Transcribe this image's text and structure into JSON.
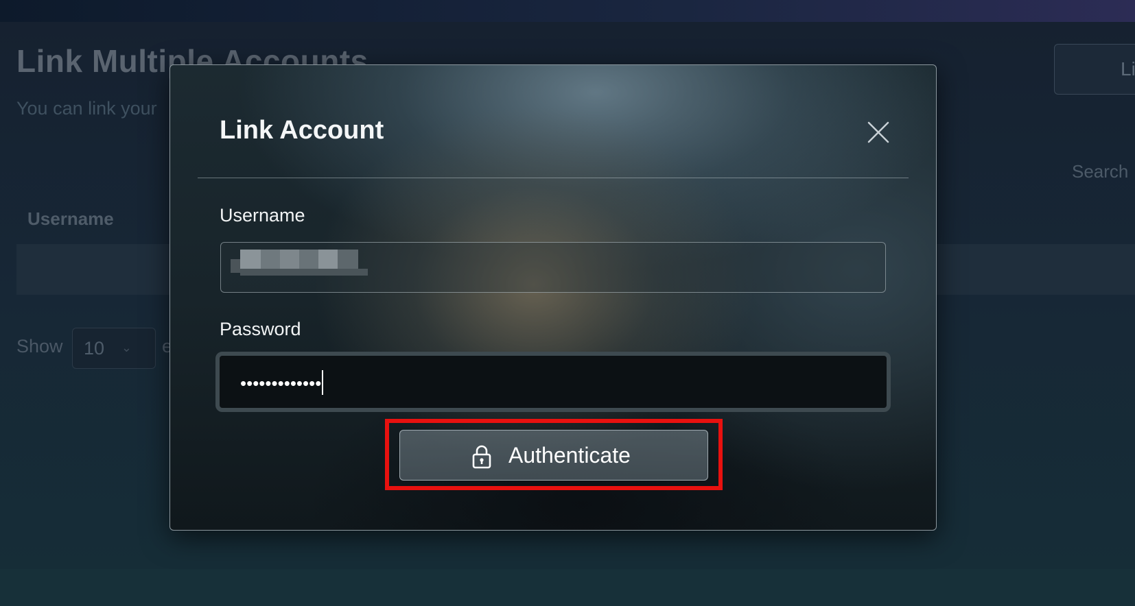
{
  "background": {
    "title": "Link Multiple Accounts",
    "subtitle": "You can link your",
    "link_button_label": "Li",
    "search_label": "Search",
    "table_header_username": "Username",
    "show_label": "Show",
    "entries_value": "10",
    "entries_trailing": "e"
  },
  "modal": {
    "title": "Link Account",
    "username_label": "Username",
    "username_value_redacted": true,
    "password_label": "Password",
    "password_value": "•••••••••••••",
    "authenticate_label": "Authenticate"
  },
  "icons": {
    "close": "close-icon",
    "lock": "lock-icon",
    "chevron": "chevron-down-icon"
  },
  "colors": {
    "highlight": "#e8110f",
    "accent_text": "#ffffff"
  }
}
